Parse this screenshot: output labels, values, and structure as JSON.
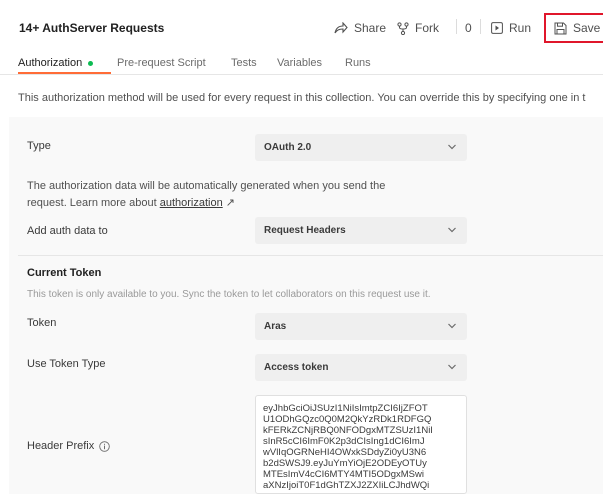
{
  "header": {
    "title": "14+ AuthServer Requests",
    "share_label": "Share",
    "fork_label": "Fork",
    "fork_count": "0",
    "run_label": "Run",
    "save_label": "Save"
  },
  "tabs": [
    {
      "label": "Authorization",
      "active": true
    },
    {
      "label": "Pre-request Script"
    },
    {
      "label": "Tests"
    },
    {
      "label": "Variables"
    },
    {
      "label": "Runs"
    }
  ],
  "intro_text": "This authorization method will be used for every request in this collection. You can override this by specifying one in t",
  "auth": {
    "type_label": "Type",
    "type_value": "OAuth 2.0",
    "help_line1": "The authorization data will be automatically generated when you send the",
    "help_line2_prefix": "request. Learn more about ",
    "help_link": "authorization",
    "help_link_arrow": "↗",
    "add_auth_label": "Add auth data to",
    "add_auth_value": "Request Headers"
  },
  "current_token": {
    "title": "Current Token",
    "note": "This token is only available to you. Sync the token to let collaborators on this request use it.",
    "token_label": "Token",
    "token_value": "Aras",
    "token_type_label": "Use Token Type",
    "token_type_value": "Access token",
    "header_prefix_label": "Header Prefix",
    "header_prefix_icon": "info-icon",
    "token_lines": [
      "eyJhbGciOiJSUzI1NiIsImtpZCI6IjZFOT",
      "U1ODhGQzc0Q0M2QkYzRDk1RDFGQ",
      "kFERkZCNjRBQ0NFODgxMTZSUzI1NiI",
      "sInR5cCI6ImF0K2p3dCIsIng1dCI6ImJ",
      "wVlIqOGRNeHI4OWxkSDdyZi0yU3N6",
      "b2dSWSJ9.eyJuYmYiOjE2ODEyOTUy",
      "MTEsImV4cCI6MTY4MTI5ODgxMSwi",
      "aXNzIjoiT0F1dGhTZXJ2ZXIiLCJhdWQi"
    ]
  },
  "colors": {
    "save_highlight": "#e0162b",
    "tab_underline": "#ff6c37",
    "active_dot": "#0cbb52"
  }
}
